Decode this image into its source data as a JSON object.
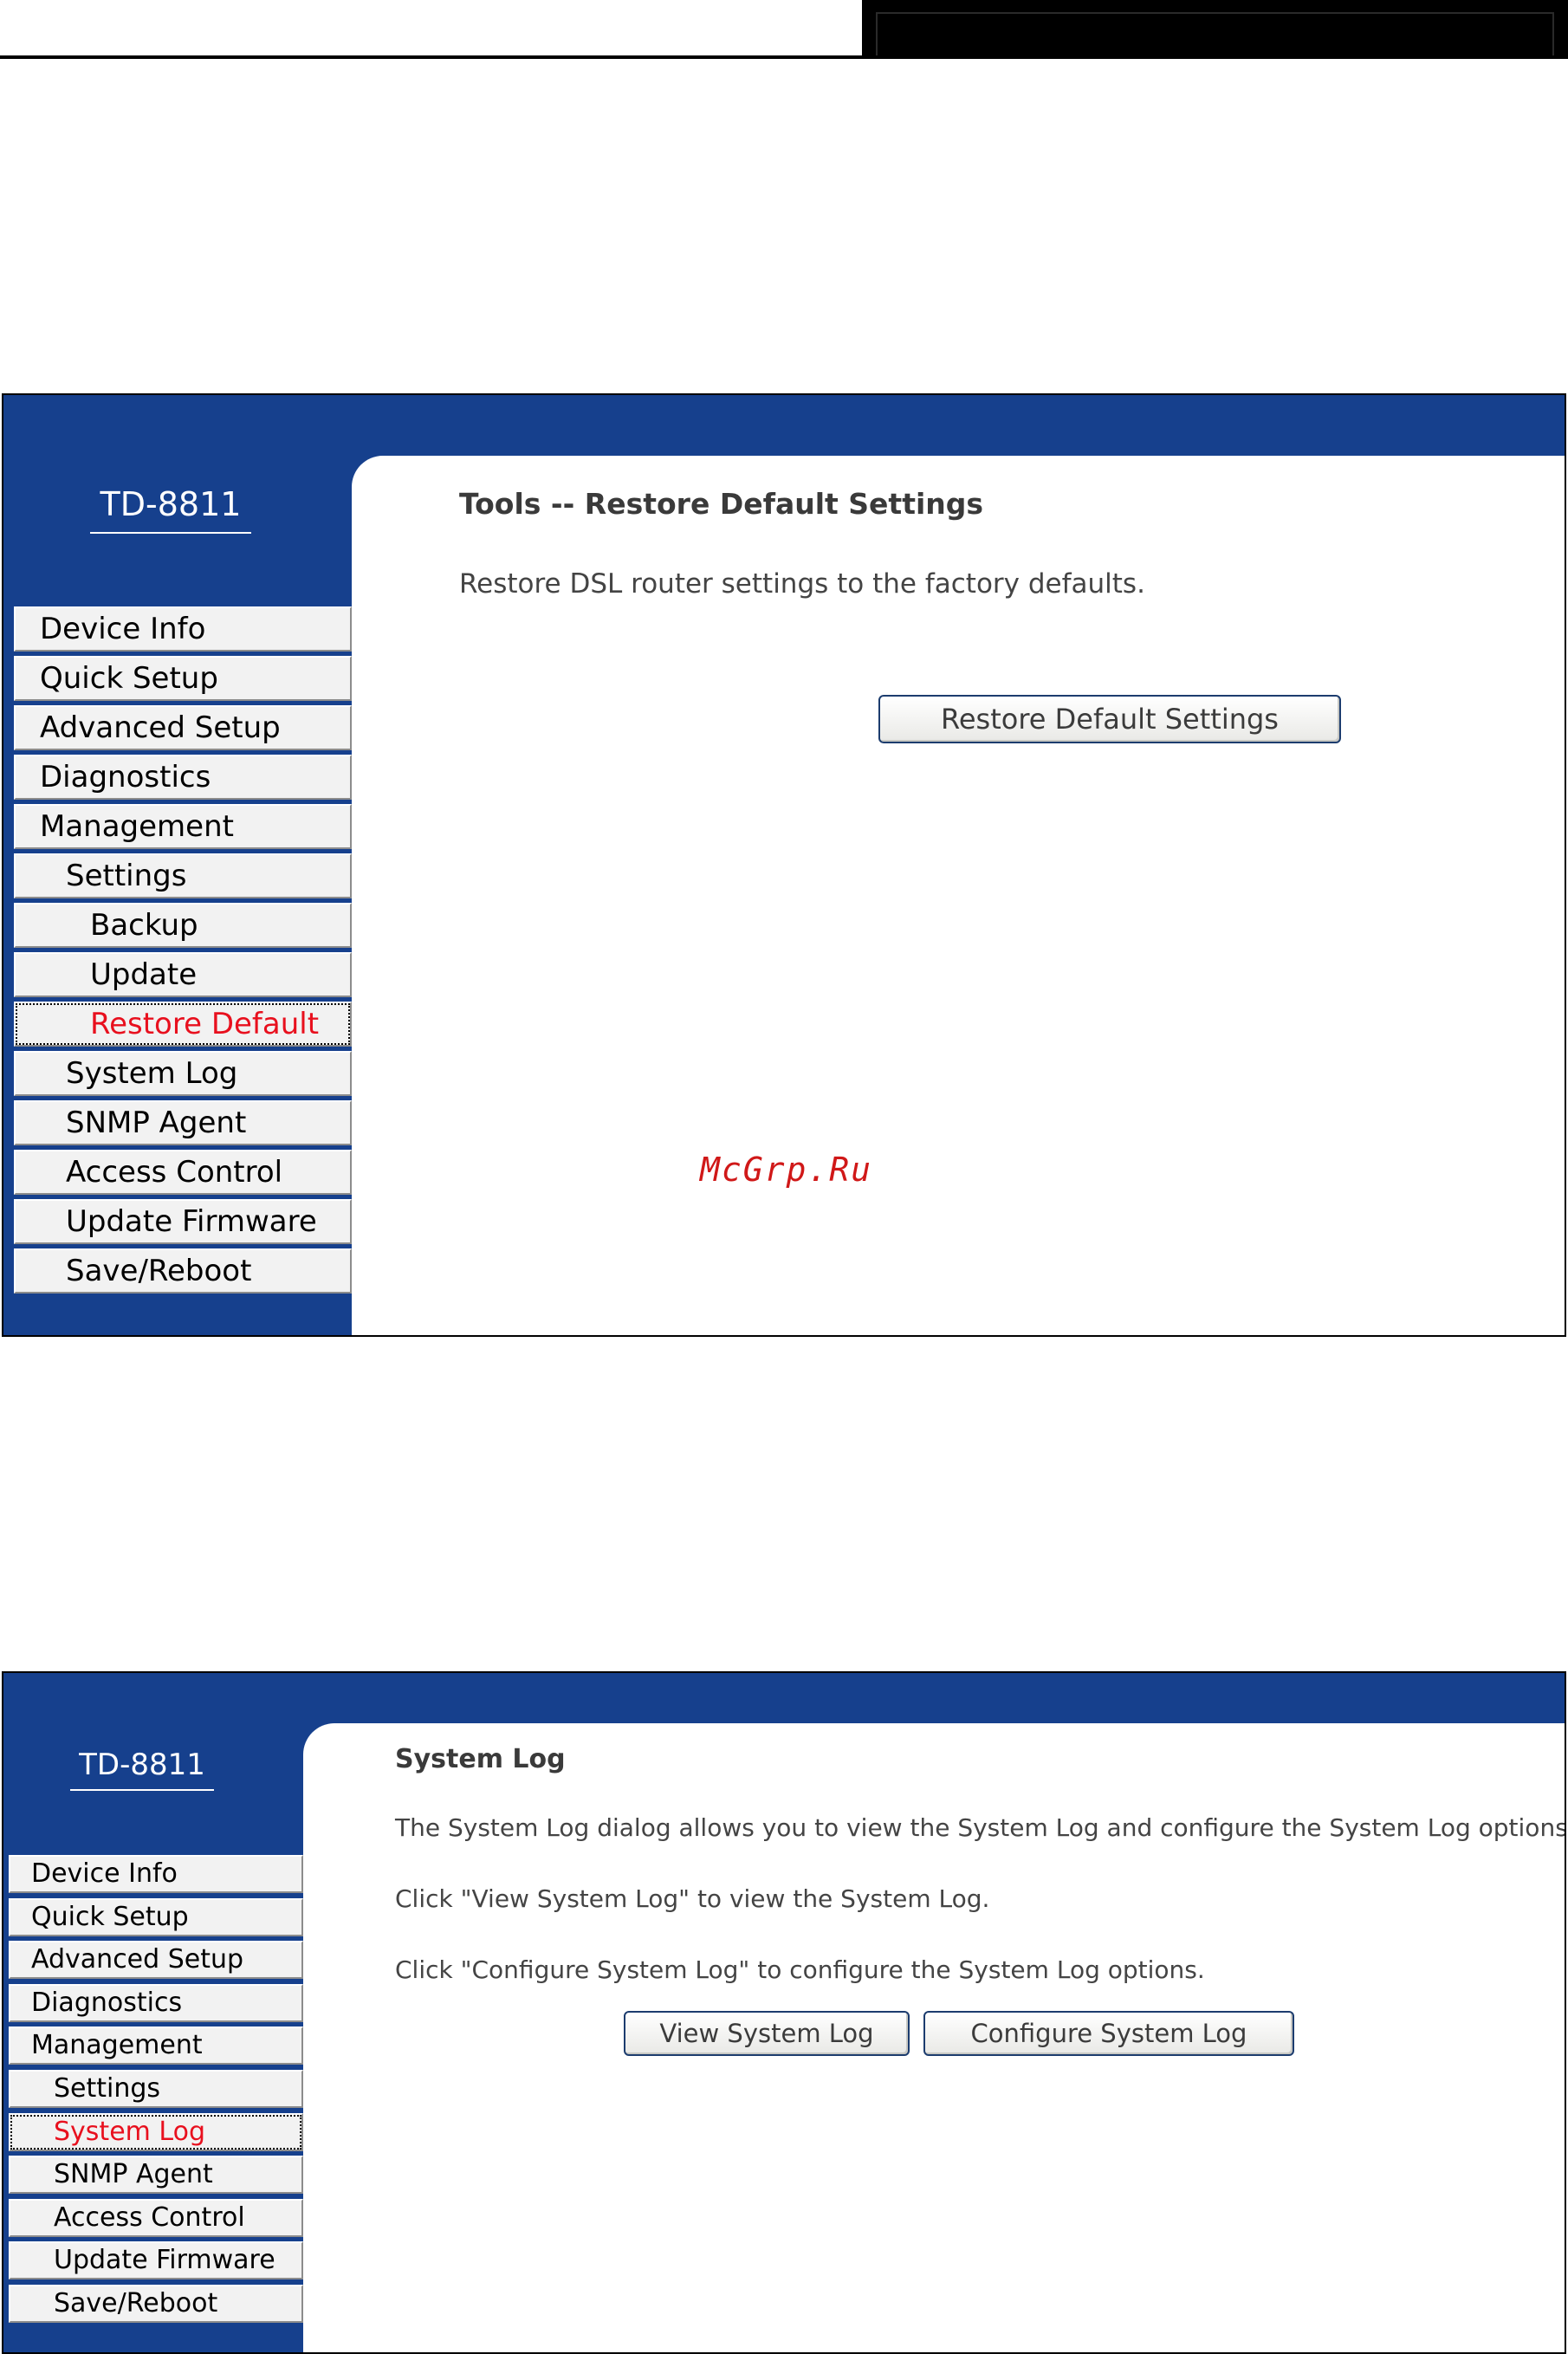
{
  "restore_page": {
    "logo": "TD-8811",
    "title": "Tools -- Restore Default Settings",
    "description": "Restore DSL router settings to the factory defaults.",
    "button_label": "Restore Default Settings",
    "menu": [
      {
        "label": "Device Info"
      },
      {
        "label": "Quick Setup"
      },
      {
        "label": "Advanced Setup"
      },
      {
        "label": "Diagnostics"
      },
      {
        "label": "Management"
      },
      {
        "label": "Settings"
      },
      {
        "label": "Backup"
      },
      {
        "label": "Update"
      },
      {
        "label": "Restore Default"
      },
      {
        "label": "System Log"
      },
      {
        "label": "SNMP Agent"
      },
      {
        "label": "Access Control"
      },
      {
        "label": "Update Firmware"
      },
      {
        "label": "Save/Reboot"
      }
    ]
  },
  "syslog_page": {
    "logo": "TD-8811",
    "title": "System Log",
    "desc1": "The System Log dialog allows you to view the System Log and configure the System Log options.",
    "desc2": "Click \"View System Log\" to view the System Log.",
    "desc3": "Click \"Configure System Log\" to configure the System Log options.",
    "view_button": "View System Log",
    "configure_button": "Configure System Log",
    "menu": [
      {
        "label": "Device Info"
      },
      {
        "label": "Quick Setup"
      },
      {
        "label": "Advanced Setup"
      },
      {
        "label": "Diagnostics"
      },
      {
        "label": "Management"
      },
      {
        "label": "Settings"
      },
      {
        "label": "System Log"
      },
      {
        "label": "SNMP Agent"
      },
      {
        "label": "Access Control"
      },
      {
        "label": "Update Firmware"
      },
      {
        "label": "Save/Reboot"
      }
    ]
  },
  "watermark": "McGrp.Ru",
  "colors": {
    "frame_blue": "#16408d",
    "active_red": "#e8101e"
  }
}
